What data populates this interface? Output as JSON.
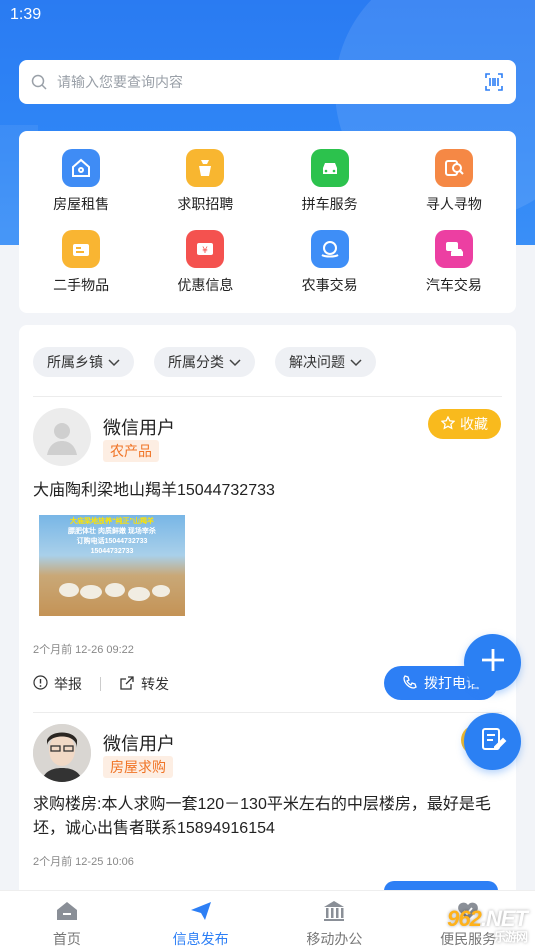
{
  "status": {
    "time": "1:39"
  },
  "search": {
    "placeholder": "请输入您要查询内容"
  },
  "categories": [
    {
      "label": "房屋租售",
      "icon": "house-icon",
      "color": "#3f8cf5"
    },
    {
      "label": "求职招聘",
      "icon": "bag-icon",
      "color": "#f8b630"
    },
    {
      "label": "拼车服务",
      "icon": "car-icon",
      "color": "#2cc24d"
    },
    {
      "label": "寻人寻物",
      "icon": "search-person-icon",
      "color": "#f58845"
    },
    {
      "label": "二手物品",
      "icon": "secondhand-icon",
      "color": "#f9b532"
    },
    {
      "label": "优惠信息",
      "icon": "coupon-icon",
      "color": "#f4524f"
    },
    {
      "label": "农事交易",
      "icon": "farm-trade-icon",
      "color": "#3e8ef7"
    },
    {
      "label": "汽车交易",
      "icon": "car-trade-icon",
      "color": "#ec3fa2"
    }
  ],
  "filters": [
    "所属乡镇",
    "所属分类",
    "解决问题"
  ],
  "posts": [
    {
      "user": "微信用户",
      "tag": "农产品",
      "fav_label": "收藏",
      "text": "大庙陶利梁地山羯羊15044732733",
      "image_lines": [
        "大庙梁地放养“纯正”山羯羊",
        "膘肥体壮 肉质鲜嫩 现场宰杀",
        "订购电话15044732733",
        "15044732733"
      ],
      "time": "2个月前 12-26 09:22",
      "report_label": "举报",
      "share_label": "转发",
      "call_label": "拨打电话"
    },
    {
      "user": "微信用户",
      "tag": "房屋求购",
      "text": "求购楼房:本人求购一套120－130平米左右的中层楼房，最好是毛坯，诚心出售者联系15894916154",
      "time": "2个月前 12-25 10:06"
    }
  ],
  "tabs": [
    {
      "label": "首页",
      "icon": "home-icon"
    },
    {
      "label": "信息发布",
      "icon": "send-icon"
    },
    {
      "label": "移动办公",
      "icon": "office-icon"
    },
    {
      "label": "便民服务",
      "icon": "heart-service-icon"
    }
  ],
  "watermark": {
    "num": "962",
    "suffix": ".NET",
    "sub": "乐游网"
  },
  "colors": {
    "primary": "#2d7ff5",
    "accent": "#f9ba1d",
    "tag": "#f07426"
  }
}
